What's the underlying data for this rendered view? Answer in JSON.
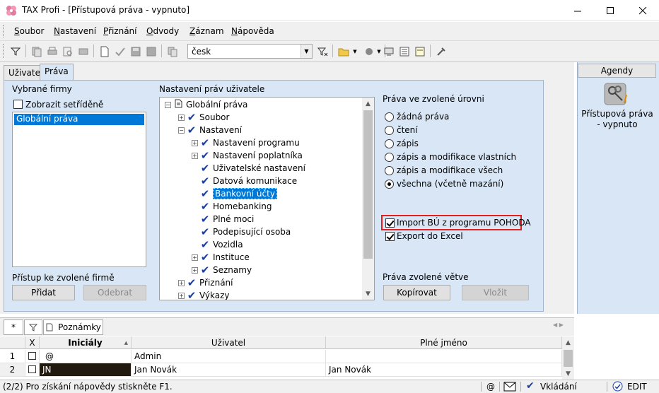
{
  "window": {
    "title": "TAX Profi - [Přístupová práva - vypnuto]"
  },
  "menu": [
    {
      "prefix": "",
      "accel": "S",
      "rest": "oubor"
    },
    {
      "prefix": "",
      "accel": "N",
      "rest": "astavení"
    },
    {
      "prefix": "",
      "accel": "P",
      "rest": "řiznání"
    },
    {
      "prefix": "",
      "accel": "O",
      "rest": "dvody"
    },
    {
      "prefix": "",
      "accel": "Z",
      "rest": "áznam"
    },
    {
      "prefix": "",
      "accel": "N",
      "rest": "ápověda"
    }
  ],
  "toolbar": {
    "combo_value": "česk"
  },
  "tabs": [
    "Uživatel",
    "Práva"
  ],
  "left": {
    "title": "Vybrané firmy",
    "sorted_label": "Zobrazit setříděně",
    "list_items": [
      "Globální práva"
    ],
    "access_label": "Přístup ke zvolené firmě",
    "add_button": "Přidat",
    "remove_button": "Odebrat"
  },
  "tree": {
    "title": "Nastavení práv uživatele",
    "items": [
      {
        "label": "Globální práva",
        "level": 0,
        "exp": "-",
        "icon": "doc"
      },
      {
        "label": "Soubor",
        "level": 1,
        "exp": "+",
        "icon": "check"
      },
      {
        "label": "Nastavení",
        "level": 1,
        "exp": "-",
        "icon": "check"
      },
      {
        "label": "Nastavení programu",
        "level": 2,
        "exp": "+",
        "icon": "check"
      },
      {
        "label": "Nastavení poplatníka",
        "level": 2,
        "exp": "+",
        "icon": "check"
      },
      {
        "label": "Uživatelské nastavení",
        "level": 2,
        "exp": "",
        "icon": "check"
      },
      {
        "label": "Datová komunikace",
        "level": 2,
        "exp": "",
        "icon": "check"
      },
      {
        "label": "Bankovní účty",
        "level": 2,
        "exp": "",
        "icon": "check",
        "selected": true
      },
      {
        "label": "Homebanking",
        "level": 2,
        "exp": "",
        "icon": "check"
      },
      {
        "label": "Plné moci",
        "level": 2,
        "exp": "",
        "icon": "check"
      },
      {
        "label": "Podepisující osoba",
        "level": 2,
        "exp": "",
        "icon": "check"
      },
      {
        "label": "Vozidla",
        "level": 2,
        "exp": "",
        "icon": "check"
      },
      {
        "label": "Instituce",
        "level": 2,
        "exp": "+",
        "icon": "check"
      },
      {
        "label": "Seznamy",
        "level": 2,
        "exp": "+",
        "icon": "check"
      },
      {
        "label": "Přiznání",
        "level": 1,
        "exp": "+",
        "icon": "check"
      },
      {
        "label": "Výkazy",
        "level": 1,
        "exp": "+",
        "icon": "check"
      }
    ]
  },
  "rights": {
    "title": "Práva ve zvolené úrovni",
    "options": [
      "žádná práva",
      "čtení",
      "zápis",
      "zápis a modifikace vlastních",
      "zápis a modifikace všech",
      "všechna (včetně mazání)"
    ],
    "selected": 5,
    "import_label": "Import BÚ z programu POHODA",
    "export_label": "Export do Excel",
    "branch_title": "Práva zvolené větve",
    "copy_button": "Kopírovat",
    "paste_button": "Vložit"
  },
  "agenda": {
    "header": "Agendy",
    "item_label": "Přístupová práva - vypnuto"
  },
  "bottom": {
    "star": "*",
    "notes_tab": "Poznámky",
    "columns": [
      "X",
      "Iniciály",
      "Uživatel",
      "Plné jméno"
    ],
    "rows": [
      {
        "num": "1",
        "initials": "@",
        "user": "Admin",
        "full": ""
      },
      {
        "num": "2",
        "initials": "JN",
        "user": "Jan Novák",
        "full": "Jan Novák"
      }
    ]
  },
  "status": {
    "text": "(2/2)  Pro získání nápovědy stiskněte F1.",
    "at": "@",
    "saving": "Vkládání",
    "mode": "EDIT"
  },
  "colors": {
    "accent": "#0078d7",
    "panel": "#d8e6f5",
    "highlight": "#e0201e"
  }
}
